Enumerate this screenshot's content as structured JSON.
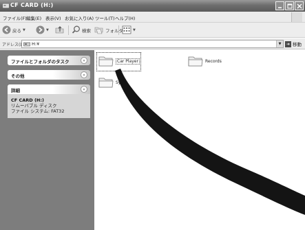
{
  "window": {
    "title": "CF CARD (H:)"
  },
  "menu": [
    {
      "label": "ファイル(F)"
    },
    {
      "label": "編集(E)"
    },
    {
      "label": "表示(V)"
    },
    {
      "label": "お気に入り(A)"
    },
    {
      "label": "ツール(T)"
    },
    {
      "label": "ヘルプ(H)"
    }
  ],
  "toolbar": {
    "back_label": "戻る",
    "search_label": "検索",
    "folders_label": "フォルダ"
  },
  "address": {
    "label": "アドレス(D)",
    "value": "H:¥",
    "go_label": "移動"
  },
  "taskpane": {
    "file_tasks_title": "ファイルとフォルダのタスク",
    "other_title": "その他",
    "details_title": "詳細",
    "details_name": "CF CARD (H:)",
    "details_type": "リムーバブル ディスク",
    "details_fs": "ファイル システム: FAT32"
  },
  "files": [
    {
      "name": "Car Player"
    },
    {
      "name": "Records"
    },
    {
      "name": "Sys"
    }
  ],
  "icons": {
    "title": "drive-icon",
    "back": "back-arrow-icon",
    "forward": "forward-arrow-icon",
    "up": "up-folder-icon",
    "search": "search-icon",
    "folders": "folders-icon",
    "views": "views-icon",
    "folder": "folder-icon",
    "go": "go-arrow-icon"
  }
}
